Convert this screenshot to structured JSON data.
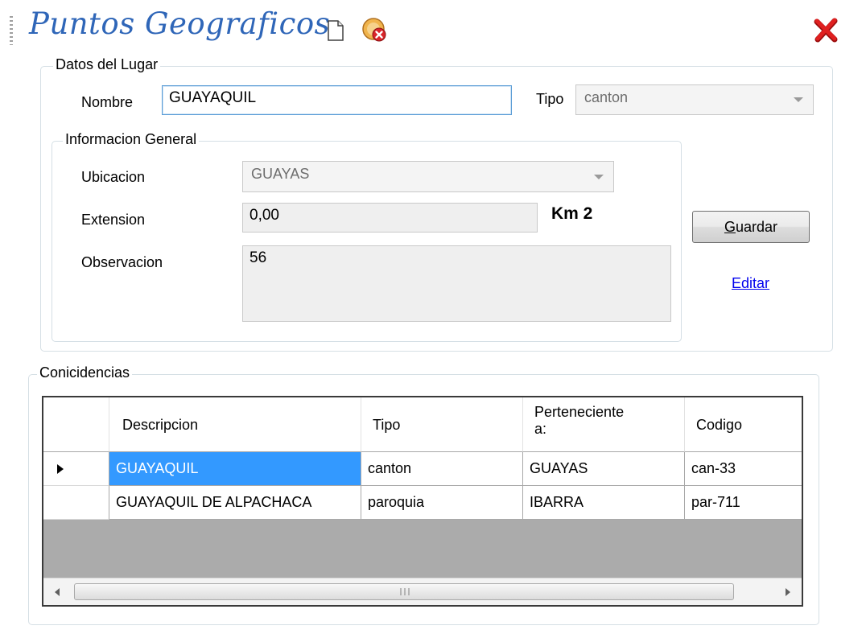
{
  "window": {
    "title": "Puntos Geograficos"
  },
  "datos_del_lugar": {
    "legend": "Datos del Lugar",
    "nombre_label": "Nombre",
    "nombre_value": "GUAYAQUIL",
    "tipo_label": "Tipo",
    "tipo_value": "canton"
  },
  "informacion_general": {
    "legend": "Informacion General",
    "ubicacion_label": "Ubicacion",
    "ubicacion_value": "GUAYAS",
    "extension_label": "Extension",
    "extension_value": "0,00",
    "extension_unit": "Km 2",
    "observacion_label": "Observacion",
    "observacion_value": "56"
  },
  "actions": {
    "guardar_label": "Guardar",
    "guardar_mnemonic": "G",
    "guardar_rest": "uardar",
    "editar_label": "Editar"
  },
  "coincidencias": {
    "legend": "Conicidencias",
    "columns": [
      "Descripcion",
      "Tipo",
      "Perteneciente a:",
      "Codigo"
    ],
    "rows": [
      {
        "descripcion": "GUAYAQUIL",
        "tipo": "canton",
        "perteneciente": "GUAYAS",
        "codigo": "can-33",
        "current": true
      },
      {
        "descripcion": "GUAYAQUIL DE ALPACHACA",
        "tipo": "paroquia",
        "perteneciente": "IBARRA",
        "codigo": "par-711",
        "current": false
      }
    ]
  },
  "icons": {
    "grip": "toolstrip-grip-icon",
    "new": "new-document-icon",
    "cancel": "cancel-document-icon",
    "close": "close-icon",
    "row_pointer": "row-pointer-icon",
    "scroll_left": "scroll-left-icon",
    "scroll_right": "scroll-right-icon"
  },
  "colors": {
    "title": "#2f66b8",
    "selection": "#3399ff",
    "link": "#0000ee",
    "close": "#e02020"
  }
}
